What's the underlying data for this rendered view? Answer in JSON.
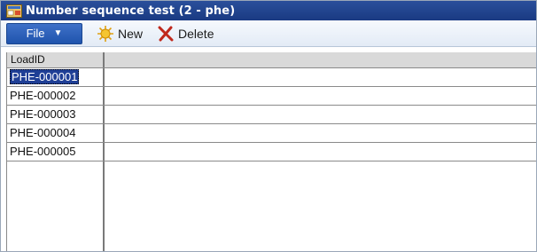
{
  "window": {
    "title": "Number sequence test (2 - phe)"
  },
  "actionbar": {
    "file_label": "File",
    "new_label": "New",
    "delete_label": "Delete"
  },
  "grid": {
    "columns": [
      "LoadID"
    ],
    "rows": [
      {
        "load_id": "PHE-000001",
        "selected": true
      },
      {
        "load_id": "PHE-000002",
        "selected": false
      },
      {
        "load_id": "PHE-000003",
        "selected": false
      },
      {
        "load_id": "PHE-000004",
        "selected": false
      },
      {
        "load_id": "PHE-000005",
        "selected": false
      }
    ]
  },
  "colors": {
    "titlebar": "#1f4590",
    "file_button": "#2a5fb8",
    "selection": "#1f3f96"
  },
  "icons": {
    "app": "app-form-icon",
    "new": "new-star-icon",
    "delete": "delete-x-icon",
    "file_menu": "chevron-down-icon"
  }
}
